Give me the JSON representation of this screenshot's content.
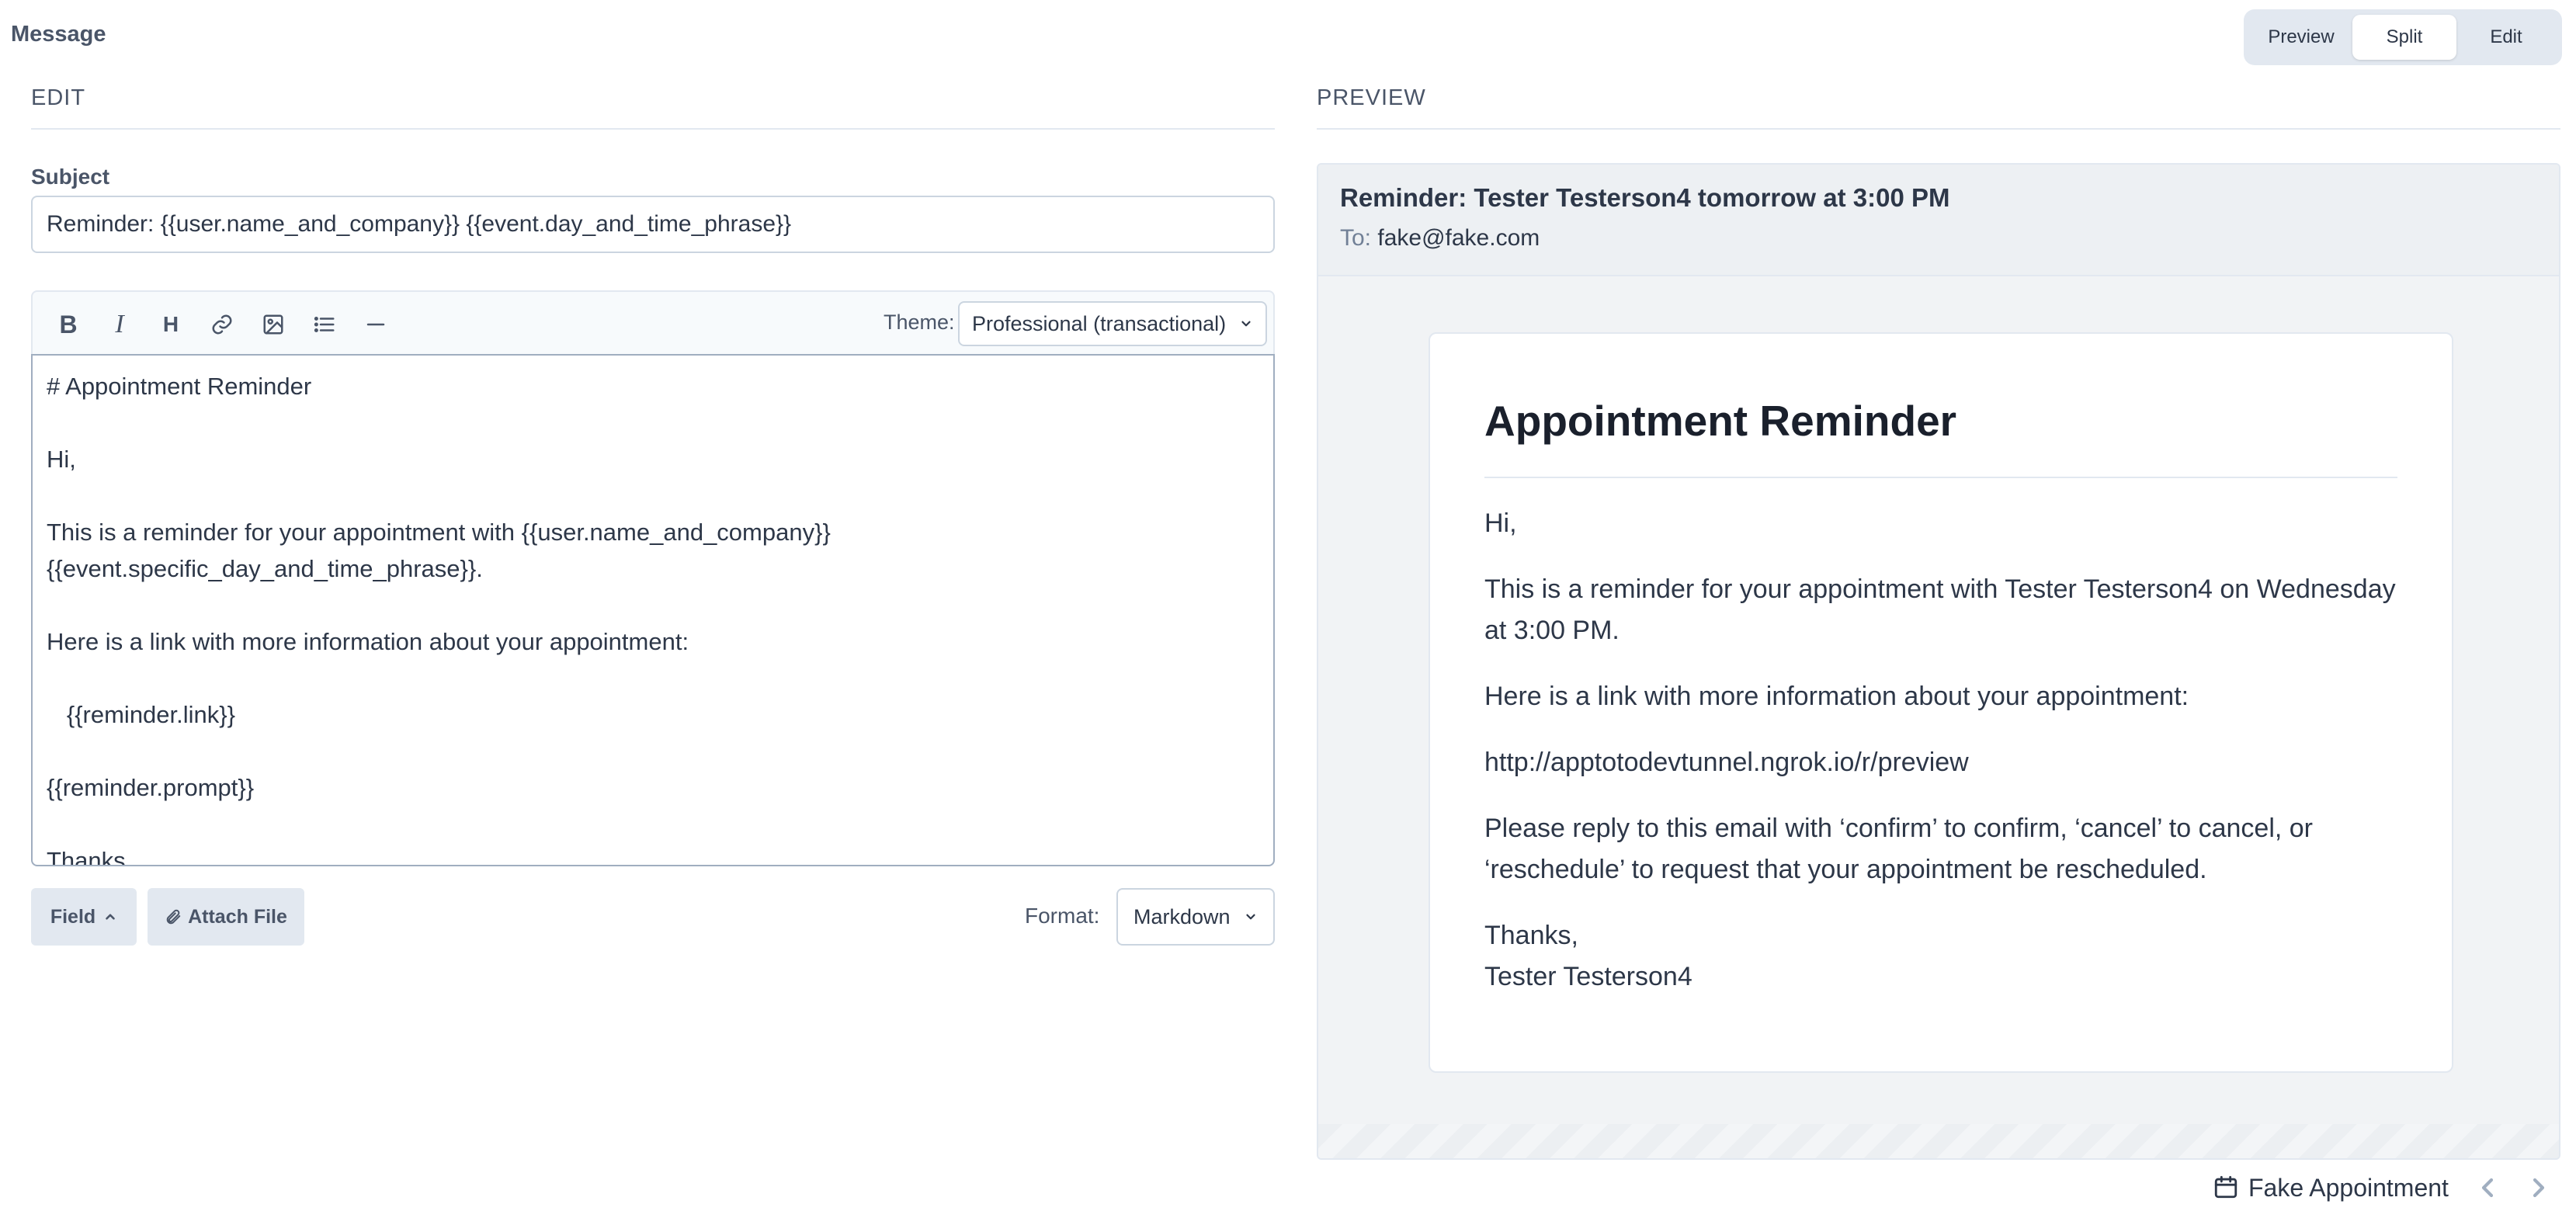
{
  "page": {
    "title": "Message"
  },
  "view_toggle": {
    "preview": "Preview",
    "split": "Split",
    "edit": "Edit",
    "selected": "Split"
  },
  "edit_section": {
    "header": "EDIT",
    "subject_label": "Subject",
    "subject_value": "Reminder: {{user.name_and_company}} {{event.day_and_time_phrase}}",
    "toolbar": {
      "bold_icon": "bold-icon",
      "italic_icon": "italic-icon",
      "heading_icon": "heading-icon",
      "link_icon": "link-icon",
      "image_icon": "image-icon",
      "list_icon": "list-icon",
      "hr_icon": "horizontal-rule-icon",
      "theme_label": "Theme:",
      "theme_value": "Professional (transactional)"
    },
    "editor_lines": [
      "# Appointment Reminder",
      "",
      "Hi,",
      "",
      "This is a reminder for your appointment with {{user.name_and_company}}",
      "{{event.specific_day_and_time_phrase}}.",
      "",
      "Here is a link with more information about your appointment:",
      "",
      "   {{reminder.link}}",
      "",
      "{{reminder.prompt}}",
      "",
      "Thanks,"
    ],
    "field_button": "Field",
    "attach_button": "Attach File",
    "format_label": "Format:",
    "format_value": "Markdown"
  },
  "preview_section": {
    "header": "PREVIEW",
    "subject": "Reminder: Tester Testerson4 tomorrow at 3:00 PM",
    "to_label": "To:",
    "to_value": "fake@fake.com",
    "email": {
      "heading": "Appointment Reminder",
      "greeting": "Hi,",
      "para1": "This is a reminder for your appointment with Tester Testerson4 on Wednesday at 3:00 PM.",
      "para2": "Here is a link with more information about your appointment:",
      "link": "http://apptotodevtunnel.ngrok.io/r/preview",
      "para3": "Please reply to this email with ‘confirm’ to confirm, ‘cancel’ to cancel, or ‘reschedule’ to request that your appointment be rescheduled.",
      "signoff": "Thanks,",
      "signature": "Tester Testerson4"
    }
  },
  "footer": {
    "appointment_label": "Fake Appointment"
  },
  "colors": {
    "accent_bg": "#e2e8f0",
    "text": "#2d3748",
    "muted": "#4a5568",
    "border": "#cbd5e0"
  }
}
